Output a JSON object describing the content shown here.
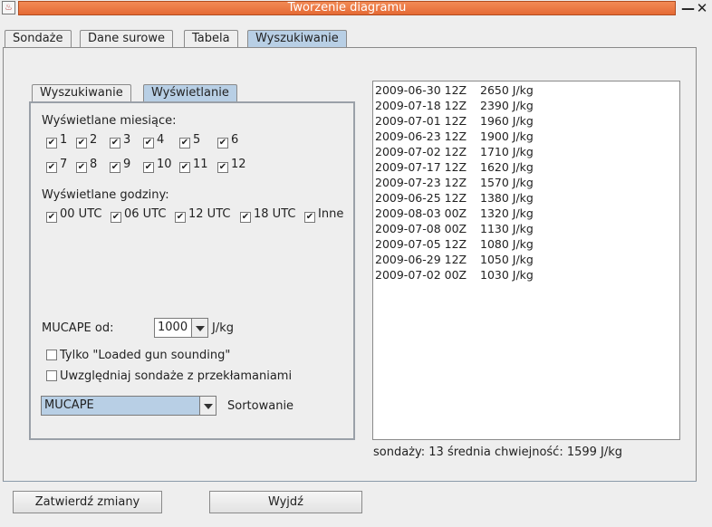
{
  "window": {
    "title": "Tworzenie diagramu",
    "minimize": "—",
    "close": "✕"
  },
  "tabs": [
    "Sondaże",
    "Dane surowe",
    "Tabela",
    "Wyszukiwanie"
  ],
  "inner_tabs": [
    "Wyszukiwanie",
    "Wyświetlanie"
  ],
  "display": {
    "months_label": "Wyświetlane miesiące:",
    "months": [
      "1",
      "2",
      "3",
      "4",
      "5",
      "6",
      "7",
      "8",
      "9",
      "10",
      "11",
      "12"
    ],
    "hours_label": "Wyświetlane godziny:",
    "hours": [
      "00 UTC",
      "06 UTC",
      "12 UTC",
      "18 UTC",
      "Inne"
    ],
    "mucape_label": "MUCAPE od:",
    "mucape_value": "1000",
    "mucape_unit": "J/kg",
    "loaded_gun_label": "Tylko \"Loaded gun sounding\"",
    "include_bad_label": "Uwzględniaj sondaże z przekłamaniami",
    "sort_value": "MUCAPE",
    "sort_label": "Sortowanie"
  },
  "results": [
    {
      "date": "2009-06-30 12Z",
      "value": "2650 J/kg"
    },
    {
      "date": "2009-07-18 12Z",
      "value": "2390 J/kg"
    },
    {
      "date": "2009-07-01 12Z",
      "value": "1960 J/kg"
    },
    {
      "date": "2009-06-23 12Z",
      "value": "1900 J/kg"
    },
    {
      "date": "2009-07-02 12Z",
      "value": "1710 J/kg"
    },
    {
      "date": "2009-07-17 12Z",
      "value": "1620 J/kg"
    },
    {
      "date": "2009-07-23 12Z",
      "value": "1570 J/kg"
    },
    {
      "date": "2009-06-25 12Z",
      "value": "1380 J/kg"
    },
    {
      "date": "2009-08-03 00Z",
      "value": "1320 J/kg"
    },
    {
      "date": "2009-07-08 00Z",
      "value": "1130 J/kg"
    },
    {
      "date": "2009-07-05 12Z",
      "value": "1080 J/kg"
    },
    {
      "date": "2009-06-29 12Z",
      "value": "1050 J/kg"
    },
    {
      "date": "2009-07-02 00Z",
      "value": "1030 J/kg"
    }
  ],
  "summary": "sondaży: 13 średnia chwiejność: 1599 J/kg",
  "buttons": {
    "confirm": "Zatwierdź zmiany",
    "exit": "Wyjdź"
  },
  "colors": {
    "title_bar": "#e56a35",
    "active_tab": "#b8cfe5"
  }
}
